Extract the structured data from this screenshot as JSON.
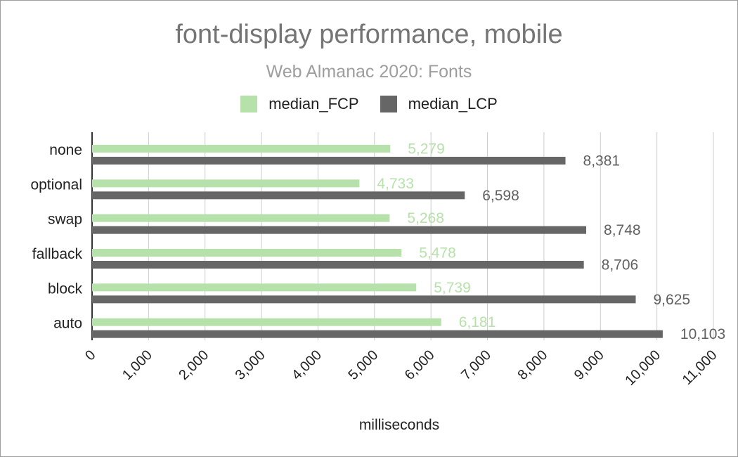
{
  "chart_data": {
    "type": "bar",
    "orientation": "horizontal",
    "title": "font-display performance, mobile",
    "subtitle": "Web Almanac 2020: Fonts",
    "xlabel": "milliseconds",
    "ylabel": "",
    "categories": [
      "none",
      "optional",
      "swap",
      "fallback",
      "block",
      "auto"
    ],
    "series": [
      {
        "name": "median_FCP",
        "color": "#b7e1aa",
        "label_color": "#b7e1aa",
        "values": [
          5279,
          4733,
          5268,
          5478,
          5739,
          6181
        ],
        "labels": [
          "5,279",
          "4,733",
          "5,268",
          "5,478",
          "5,739",
          "6,181"
        ]
      },
      {
        "name": "median_LCP",
        "color": "#666666",
        "label_color": "#616161",
        "values": [
          8381,
          6598,
          8748,
          8706,
          9625,
          10103
        ],
        "labels": [
          "8,381",
          "6,598",
          "8,748",
          "8,706",
          "9,625",
          "10,103"
        ]
      }
    ],
    "xlim": [
      0,
      11000
    ],
    "xticks": [
      0,
      1000,
      2000,
      3000,
      4000,
      5000,
      6000,
      7000,
      8000,
      9000,
      10000,
      11000
    ],
    "xtick_labels": [
      "0",
      "1,000",
      "2,000",
      "3,000",
      "4,000",
      "5,000",
      "6,000",
      "7,000",
      "8,000",
      "9,000",
      "10,000",
      "11,000"
    ],
    "grid": true,
    "legend_position": "top"
  }
}
